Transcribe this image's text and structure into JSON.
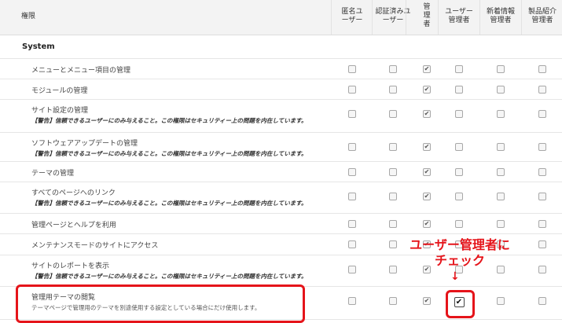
{
  "header": {
    "permission_label": "権限",
    "columns": [
      {
        "id": "anonymous",
        "label": "匿名ユ ーザー"
      },
      {
        "id": "authenticated",
        "label": "認証済みユ ーザー"
      },
      {
        "id": "admin",
        "label": "管 理 者"
      },
      {
        "id": "user_manager",
        "label": "ユーザー 管理者"
      },
      {
        "id": "news_manager",
        "label": "新着情報 管理者"
      },
      {
        "id": "product_manager",
        "label": "製品紹介 管理者"
      }
    ]
  },
  "section": {
    "title": "System"
  },
  "permissions": [
    {
      "name": "メニューとメニュー項目の管理",
      "warning": "",
      "description": "",
      "checked": [
        false,
        false,
        true,
        false,
        false,
        false
      ]
    },
    {
      "name": "モジュールの管理",
      "warning": "",
      "description": "",
      "checked": [
        false,
        false,
        true,
        false,
        false,
        false
      ]
    },
    {
      "name": "サイト設定の管理",
      "warning": "【警告】信頼できるユーザーにのみ与えること。この権限はセキュリティー上の問題を内在しています。",
      "description": "",
      "checked": [
        false,
        false,
        true,
        false,
        false,
        false
      ]
    },
    {
      "name": "ソフトウェアアップデートの管理",
      "warning": "【警告】信頼できるユーザーにのみ与えること。この権限はセキュリティー上の問題を内在しています。",
      "description": "",
      "checked": [
        false,
        false,
        true,
        false,
        false,
        false
      ]
    },
    {
      "name": "テーマの管理",
      "warning": "",
      "description": "",
      "checked": [
        false,
        false,
        true,
        false,
        false,
        false
      ]
    },
    {
      "name": "すべてのページへのリンク",
      "warning": "【警告】信頼できるユーザーにのみ与えること。この権限はセキュリティー上の問題を内在しています。",
      "description": "",
      "checked": [
        false,
        false,
        true,
        false,
        false,
        false
      ]
    },
    {
      "name": "管理ページとヘルプを利用",
      "warning": "",
      "description": "",
      "checked": [
        false,
        false,
        true,
        false,
        false,
        false
      ]
    },
    {
      "name": "メンテナンスモードのサイトにアクセス",
      "warning": "",
      "description": "",
      "checked": [
        false,
        false,
        true,
        false,
        false,
        false
      ]
    },
    {
      "name": "サイトのレポートを表示",
      "warning": "【警告】信頼できるユーザーにのみ与えること。この権限はセキュリティー上の問題を内在しています。",
      "description": "",
      "checked": [
        false,
        false,
        true,
        false,
        false,
        false
      ]
    },
    {
      "name": "管理用テーマの閲覧",
      "warning": "",
      "description": "テーマページで管理用のテーマを別途使用する設定としている場合にだけ使用します。",
      "checked": [
        false,
        false,
        true,
        true,
        false,
        false
      ]
    }
  ],
  "annotation": {
    "text_line1": "ユーザー管理者に",
    "text_line2": "チェック",
    "arrow": "↓",
    "color": "#e5141a"
  }
}
